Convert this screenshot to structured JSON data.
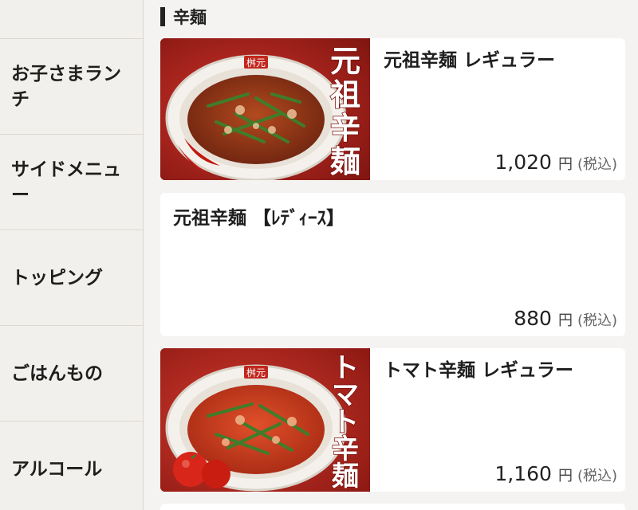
{
  "sidebar": {
    "items": [
      {
        "label": "お子さまランチ",
        "line1": "お子さまラン",
        "line2": "チ"
      },
      {
        "label": "サイドメニュー",
        "line1": "サイドメニュ",
        "line2": "ー"
      },
      {
        "label": "トッピング",
        "line1": "トッピング",
        "line2": ""
      },
      {
        "label": "ごはんもの",
        "line1": "ごはんもの",
        "line2": ""
      },
      {
        "label": "アルコール",
        "line1": "アルコール",
        "line2": ""
      }
    ]
  },
  "section": {
    "title": "辛麺"
  },
  "menu": [
    {
      "name": "元祖辛麺 レギュラー",
      "price": "1,020",
      "currency": "円",
      "tax": "(税込)",
      "image_text": [
        "元",
        "祖",
        "辛",
        "麺"
      ],
      "bowl_brand": "桝元",
      "has_image": true
    },
    {
      "name": "元祖辛麺 【ﾚﾃﾞｨｰｽ】",
      "price": "880",
      "currency": "円",
      "tax": "(税込)",
      "has_image": false
    },
    {
      "name": "トマト辛麺 レギュラー",
      "price": "1,160",
      "currency": "円",
      "tax": "(税込)",
      "image_text": [
        "ト",
        "マ",
        "ト",
        "辛",
        "麺"
      ],
      "bowl_brand": "桝元",
      "has_image": true
    }
  ],
  "colors": {
    "image_bg": "#b0201b",
    "soup_red": "#c23a1e",
    "chive": "#3f7d2a"
  }
}
